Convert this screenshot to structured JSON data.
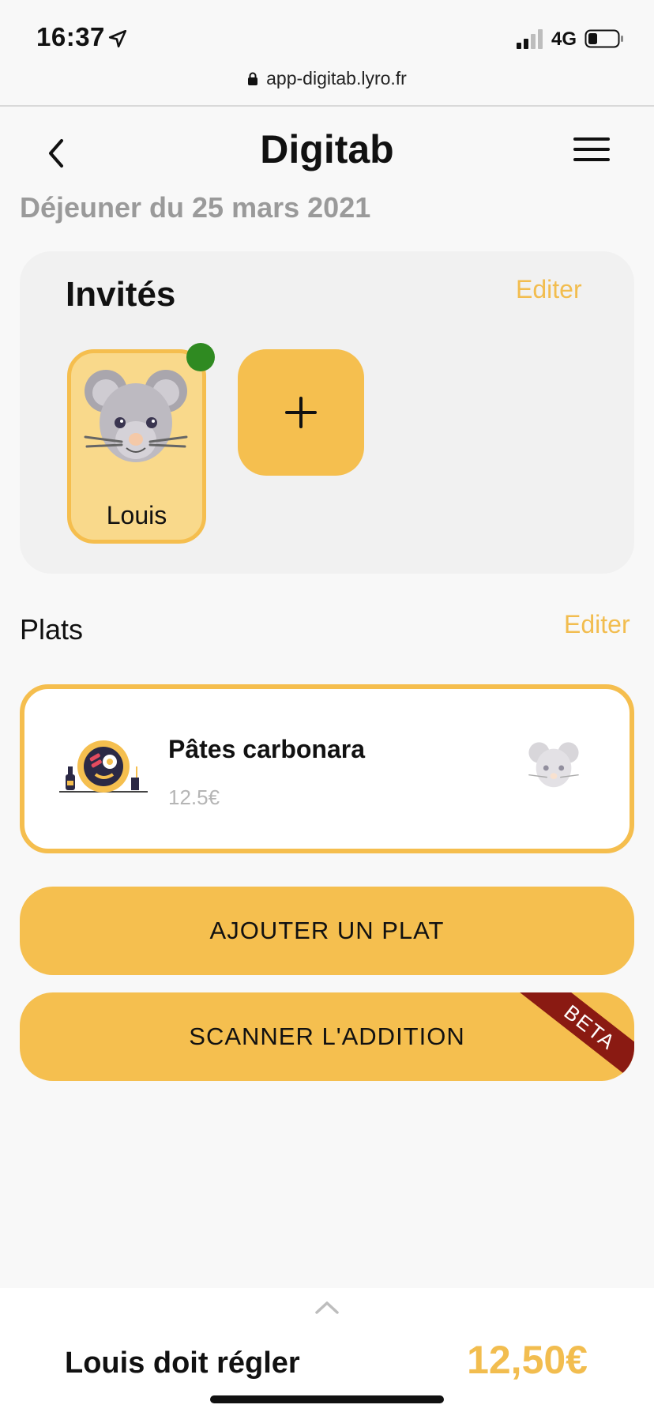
{
  "status_bar": {
    "time": "16:37",
    "network": "4G",
    "icons": [
      "location-arrow-icon",
      "signal-icon",
      "battery-icon"
    ]
  },
  "browser": {
    "url": "app-digitab.lyro.fr",
    "icon": "lock-icon"
  },
  "header": {
    "title": "Digitab",
    "back_icon": "chevron-left-icon",
    "menu_icon": "hamburger-menu-icon"
  },
  "subtitle": "Déjeuner du 25 mars 2021",
  "guests": {
    "title": "Invités",
    "edit_label": "Editer",
    "items": [
      {
        "name": "Louis",
        "avatar": "mouse-icon",
        "online": true
      }
    ],
    "add_icon": "plus-icon"
  },
  "plates": {
    "title": "Plats",
    "edit_label": "Editer",
    "items": [
      {
        "name": "Pâtes carbonara",
        "price": "12.5€",
        "image": "dish-illustration-icon",
        "assignee_avatar": "mouse-icon"
      }
    ]
  },
  "actions": {
    "add_dish_label": "AJOUTER UN PLAT",
    "scan_bill_label": "SCANNER L'ADDITION",
    "beta_label": "BETA"
  },
  "summary": {
    "label": "Louis doit régler",
    "amount": "12,50€",
    "expand_icon": "chevron-up-icon"
  },
  "colors": {
    "accent": "#f5bf4f",
    "accent_text": "#f2bd4f",
    "online": "#2f8a21",
    "beta_ribbon": "#8a1a12",
    "muted_text": "#9a9a9a"
  }
}
